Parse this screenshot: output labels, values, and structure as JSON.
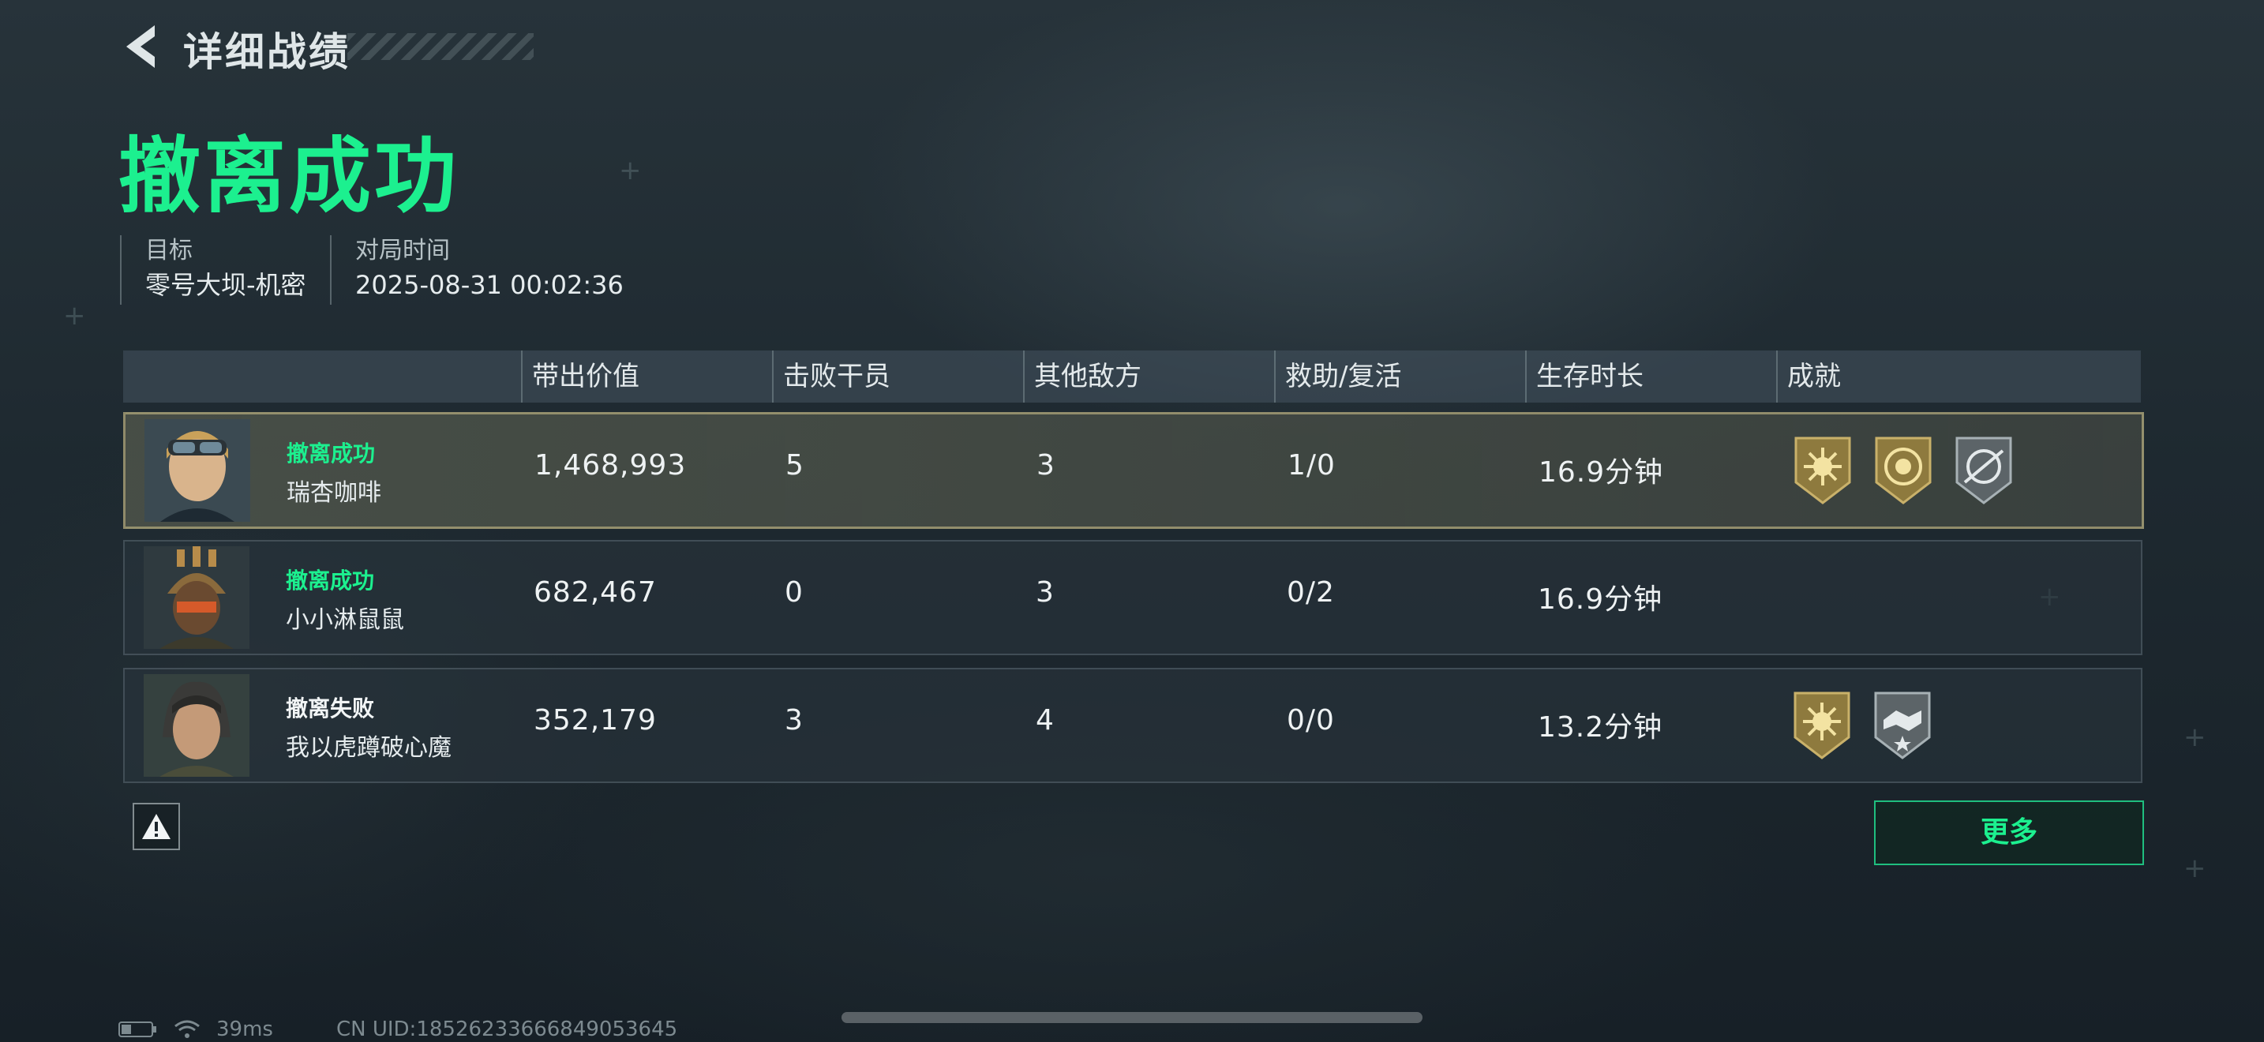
{
  "header": {
    "title": "详细战绩",
    "back_icon": "chevron-left-icon"
  },
  "result": {
    "title": "撤离成功",
    "accent": "#1cf08f"
  },
  "info": {
    "target_label": "目标",
    "target_value": "零号大坝-机密",
    "time_label": "对局时间",
    "time_value": "2025-08-31 00:02:36"
  },
  "table": {
    "columns": [
      "带出价值",
      "击败干员",
      "其他敌方",
      "救助/复活",
      "生存时长",
      "成就"
    ],
    "rows": [
      {
        "status": "撤离成功",
        "status_type": "success",
        "name": "瑞杏咖啡",
        "value": "1,468,993",
        "kills": "5",
        "other": "3",
        "assist": "1/0",
        "survival": "16.9分钟",
        "badges": [
          "gold-sun-badge-icon",
          "gold-emblem-badge-icon",
          "silver-target-badge-icon"
        ]
      },
      {
        "status": "撤离成功",
        "status_type": "success",
        "name": "小小淋鼠鼠",
        "value": "682,467",
        "kills": "0",
        "other": "3",
        "assist": "0/2",
        "survival": "16.9分钟",
        "badges": []
      },
      {
        "status": "撤离失败",
        "status_type": "fail",
        "name": "我以虎蹲破心魔",
        "value": "352,179",
        "kills": "3",
        "other": "4",
        "assist": "0/0",
        "survival": "13.2分钟",
        "badges": [
          "gold-sun-badge-icon",
          "silver-handshake-badge-icon"
        ]
      }
    ]
  },
  "buttons": {
    "more_label": "更多",
    "warning_icon": "warning-icon"
  },
  "statusbar": {
    "ping": "39ms",
    "uid": "CN UID:1852623366684905364​5"
  }
}
